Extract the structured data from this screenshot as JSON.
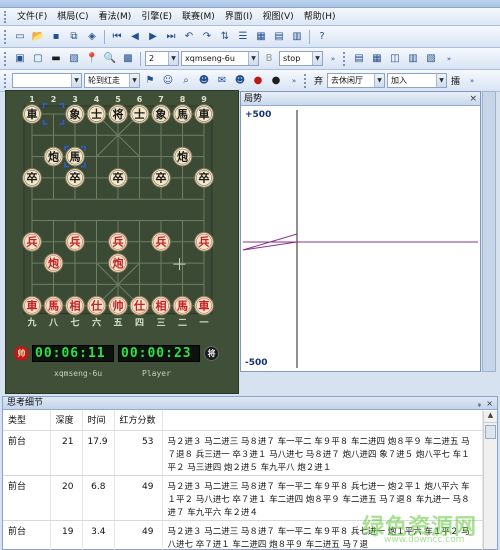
{
  "menu": [
    "文件(F)",
    "棋局(C)",
    "看法(M)",
    "引擎(E)",
    "联赛(M)",
    "界面(I)",
    "视图(V)",
    "帮助(H)"
  ],
  "toolbar2": {
    "depth_value": "2",
    "engine_value": "xqmseng-6u",
    "mode_value": "stop"
  },
  "toolbar3": {
    "combo1_value": "",
    "turn_value": "轮到红走",
    "rule_label": "弃",
    "rule_value": "去休闲厅",
    "join_value": "加入",
    "right_label": "擂"
  },
  "board": {
    "top_files": [
      "1",
      "2",
      "3",
      "4",
      "5",
      "6",
      "7",
      "8",
      "9"
    ],
    "bottom_files": [
      "九",
      "八",
      "七",
      "六",
      "五",
      "四",
      "三",
      "二",
      "一"
    ],
    "black_pieces": [
      {
        "file": 0,
        "rank": 0,
        "char": "車"
      },
      {
        "file": 2,
        "rank": 0,
        "char": "象"
      },
      {
        "file": 3,
        "rank": 0,
        "char": "士"
      },
      {
        "file": 4,
        "rank": 0,
        "char": "将"
      },
      {
        "file": 5,
        "rank": 0,
        "char": "士"
      },
      {
        "file": 6,
        "rank": 0,
        "char": "象"
      },
      {
        "file": 7,
        "rank": 0,
        "char": "馬"
      },
      {
        "file": 8,
        "rank": 0,
        "char": "車"
      },
      {
        "file": 1,
        "rank": 2,
        "char": "炮"
      },
      {
        "file": 2,
        "rank": 2,
        "char": "馬"
      },
      {
        "file": 7,
        "rank": 2,
        "char": "炮"
      },
      {
        "file": 0,
        "rank": 3,
        "char": "卒"
      },
      {
        "file": 2,
        "rank": 3,
        "char": "卒"
      },
      {
        "file": 4,
        "rank": 3,
        "char": "卒"
      },
      {
        "file": 6,
        "rank": 3,
        "char": "卒"
      },
      {
        "file": 8,
        "rank": 3,
        "char": "卒"
      }
    ],
    "red_pieces": [
      {
        "file": 0,
        "rank": 6,
        "char": "兵"
      },
      {
        "file": 2,
        "rank": 6,
        "char": "兵"
      },
      {
        "file": 4,
        "rank": 6,
        "char": "兵"
      },
      {
        "file": 6,
        "rank": 6,
        "char": "兵"
      },
      {
        "file": 8,
        "rank": 6,
        "char": "兵"
      },
      {
        "file": 1,
        "rank": 7,
        "char": "炮"
      },
      {
        "file": 4,
        "rank": 7,
        "char": "炮"
      },
      {
        "file": 0,
        "rank": 9,
        "char": "車"
      },
      {
        "file": 1,
        "rank": 9,
        "char": "馬"
      },
      {
        "file": 2,
        "rank": 9,
        "char": "相"
      },
      {
        "file": 3,
        "rank": 9,
        "char": "仕"
      },
      {
        "file": 4,
        "rank": 9,
        "char": "帅"
      },
      {
        "file": 5,
        "rank": 9,
        "char": "仕"
      },
      {
        "file": 6,
        "rank": 9,
        "char": "相"
      },
      {
        "file": 7,
        "rank": 9,
        "char": "馬"
      },
      {
        "file": 8,
        "rank": 9,
        "char": "車"
      }
    ],
    "selection_marks": [
      {
        "file": 1,
        "rank": 0
      },
      {
        "file": 2,
        "rank": 2
      }
    ]
  },
  "clocks": {
    "left_badge": "帅",
    "left_time": "00:06:11",
    "right_time": "00:00:23",
    "right_badge": "将",
    "left_player": "xqmseng-6u",
    "right_player": "Player"
  },
  "trend": {
    "title": "局势",
    "close": "×",
    "top_label": "+500",
    "bottom_label": "-500"
  },
  "details": {
    "title": "思考细节",
    "pin": "ᵩ",
    "close": "×",
    "columns": [
      "类型",
      "深度",
      "时间",
      "红方分数"
    ],
    "rows": [
      {
        "type": "前台",
        "depth": "21",
        "time": "17.9",
        "score": "53",
        "moves": "马２进３ 马二进三 马８进７ 车一平二 车９平８ 车二进四 炮８平９ 车二进五 马７退８ 兵三进一 卒３进１ 马八进七 马８进７ 炮八进四 象７进５ 炮八平七 车１平２ 马三进四 炮２进５ 车九平八 炮２进１"
      },
      {
        "type": "前台",
        "depth": "20",
        "time": "6.8",
        "score": "49",
        "moves": "马２进３ 马二进三 马８进７ 车一平二 车９平８ 兵七进一 炮２平１ 炮八平六 车１平２ 马八进七 卒７进１ 车二进四 炮８平９ 车二进五 马７退８ 车九进一 马８进７ 车九平六 车２进４"
      },
      {
        "type": "前台",
        "depth": "19",
        "time": "3.4",
        "score": "49",
        "moves": "马２进３ 马二进三 马８进７ 车一平二 车９平８ 兵七进一 炮１平六 车１平２ 马八进七 卒７进１ 车二进四 炮８平９ 车二进五 马７退"
      }
    ]
  },
  "watermark": {
    "text": "绿色资源网",
    "url": "www.downcc.com"
  },
  "colors": {
    "board": "#3f4f38",
    "red_piece": "#c8202a",
    "black_piece": "#1a1a1a",
    "trend_line": "#a23aa8",
    "selection": "#2a5ed8"
  }
}
